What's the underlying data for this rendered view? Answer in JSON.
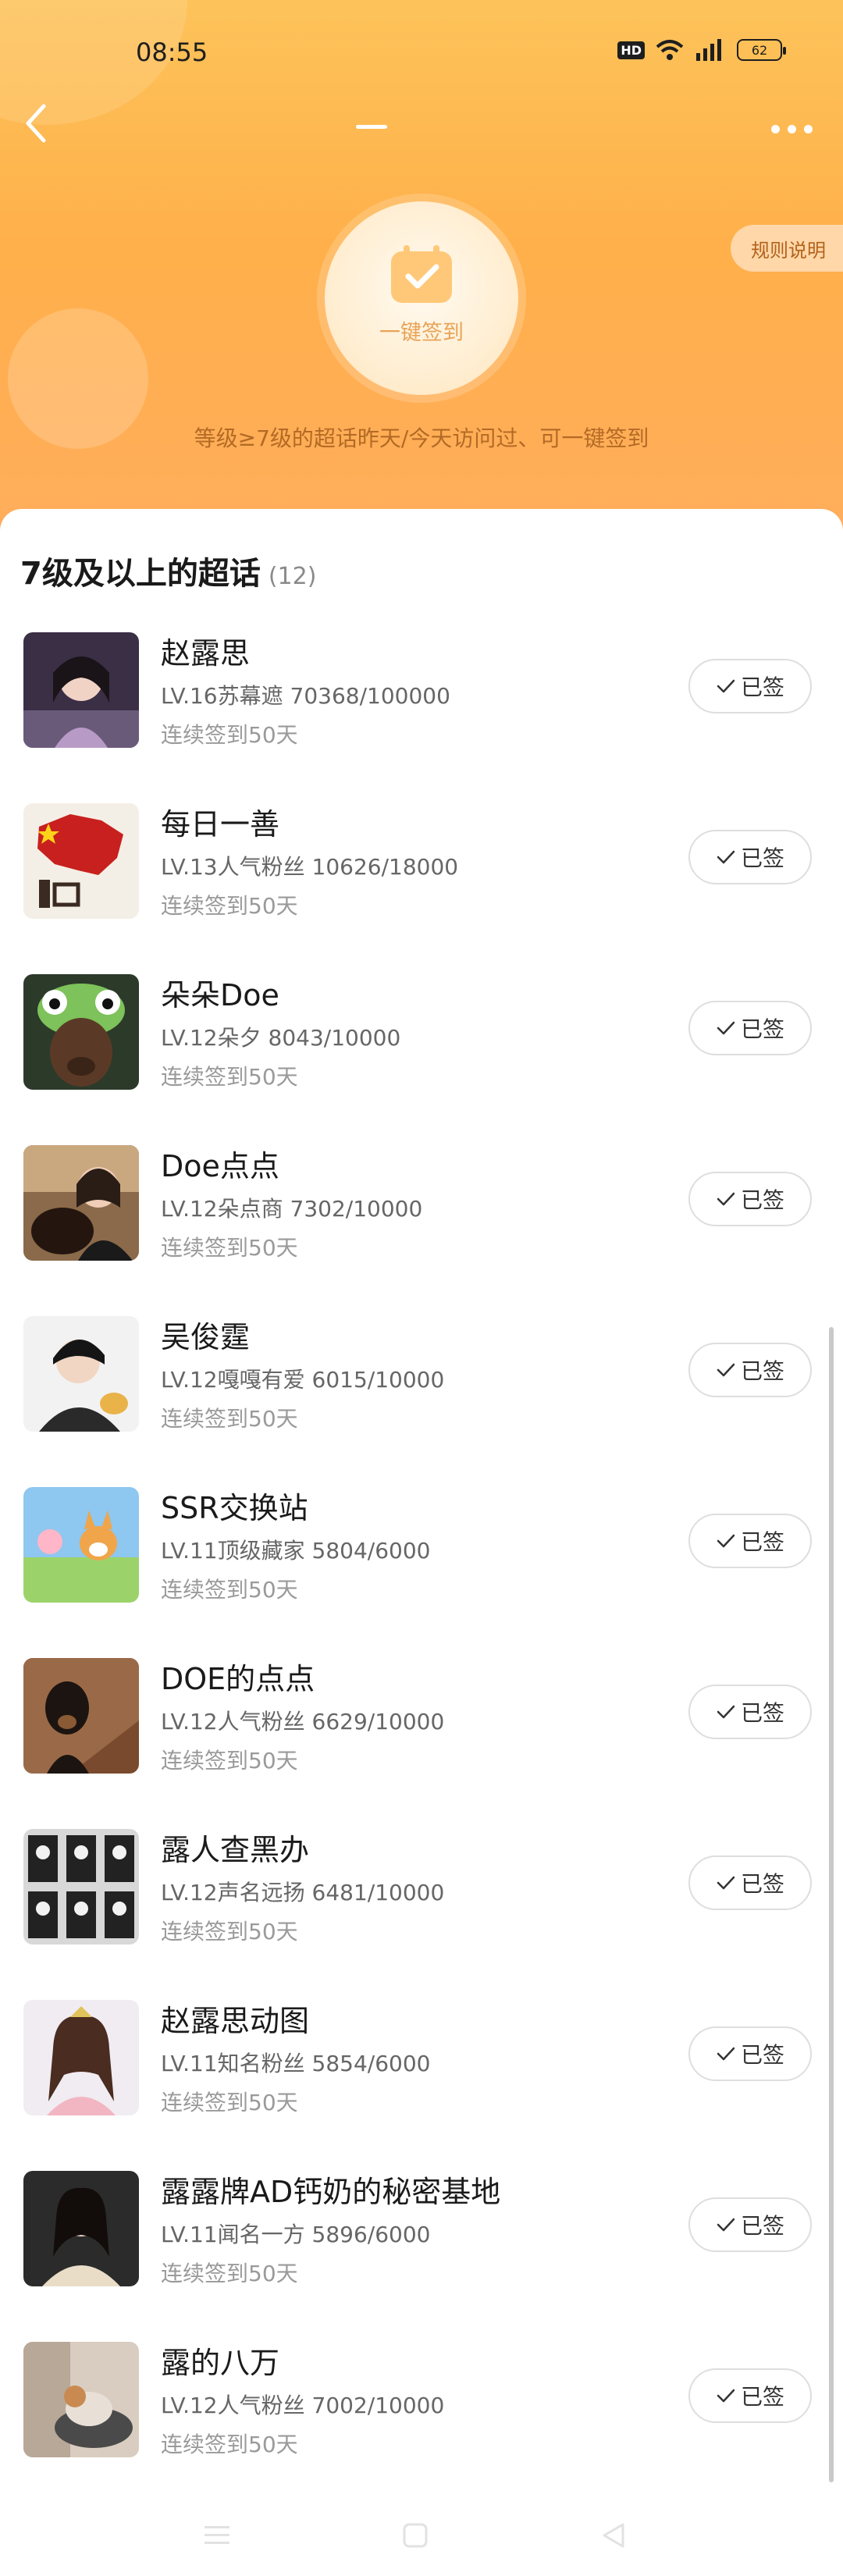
{
  "status_bar": {
    "time": "08:55",
    "hd": "HD",
    "battery": "62"
  },
  "header": {
    "checkin_label": "一键签到",
    "rules_label": "规则说明",
    "hint": "等级≥7级的超话昨天/今天访问过、可一键签到"
  },
  "section": {
    "title": "7级及以上的超话",
    "count": "(12)"
  },
  "items": [
    {
      "name": "赵露思",
      "level": "LV.16苏幕遮 70368/100000",
      "streak": "连续签到50天",
      "button": "已签"
    },
    {
      "name": "每日一善",
      "level": "LV.13人气粉丝 10626/18000",
      "streak": "连续签到50天",
      "button": "已签"
    },
    {
      "name": "朵朵Doe",
      "level": "LV.12朵夕 8043/10000",
      "streak": "连续签到50天",
      "button": "已签"
    },
    {
      "name": "Doe点点",
      "level": "LV.12朵点商 7302/10000",
      "streak": "连续签到50天",
      "button": "已签"
    },
    {
      "name": "吴俊霆",
      "level": "LV.12嘎嘎有爱 6015/10000",
      "streak": "连续签到50天",
      "button": "已签"
    },
    {
      "name": "SSR交换站",
      "level": "LV.11顶级藏家 5804/6000",
      "streak": "连续签到50天",
      "button": "已签"
    },
    {
      "name": "DOE的点点",
      "level": "LV.12人气粉丝 6629/10000",
      "streak": "连续签到50天",
      "button": "已签"
    },
    {
      "name": "露人查黑办",
      "level": "LV.12声名远扬 6481/10000",
      "streak": "连续签到50天",
      "button": "已签"
    },
    {
      "name": "赵露思动图",
      "level": "LV.11知名粉丝 5854/6000",
      "streak": "连续签到50天",
      "button": "已签"
    },
    {
      "name": "露露牌AD钙奶的秘密基地",
      "level": "LV.11闻名一方 5896/6000",
      "streak": "连续签到50天",
      "button": "已签"
    },
    {
      "name": "露的八万",
      "level": "LV.12人气粉丝 7002/10000",
      "streak": "连续签到50天",
      "button": "已签"
    }
  ],
  "colors": {
    "header_top": "#fdc35a",
    "header_bottom": "#ffad5d",
    "accent": "#e9a356",
    "hint": "#b46a25"
  }
}
